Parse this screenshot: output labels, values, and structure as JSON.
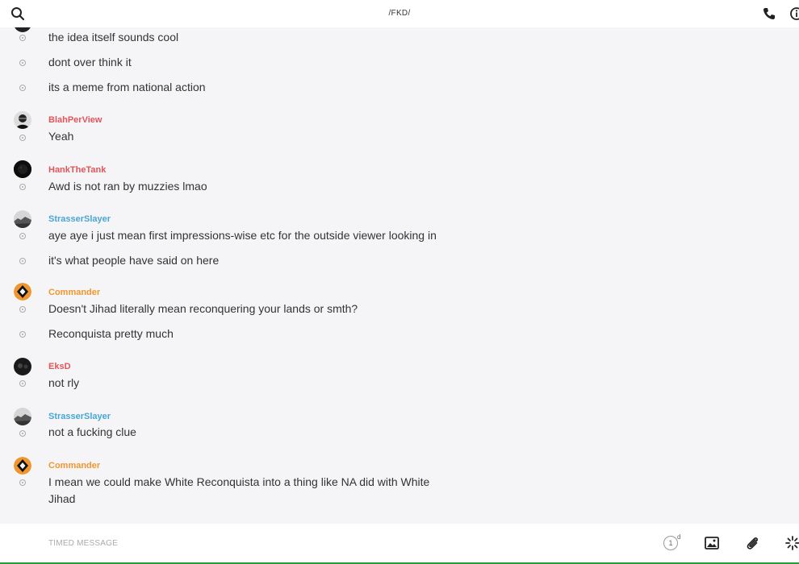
{
  "header": {
    "title": "/FKD/"
  },
  "composer": {
    "placeholder": "TIMED MESSAGE",
    "timer_value": "1",
    "timer_unit": "d"
  },
  "colors": {
    "red": "#e0555a",
    "blue": "#48a6d6",
    "orange": "#f0962e"
  },
  "messages": {
    "m0": {
      "text": "the idea itself sounds cool"
    },
    "m1": {
      "text": "dont over think it"
    },
    "m2": {
      "text": "its a meme from national action"
    },
    "m3": {
      "sender": "BlahPerView",
      "text": "Yeah"
    },
    "m4": {
      "sender": "HankTheTank",
      "text": "Awd is not ran by muzzies lmao"
    },
    "m5": {
      "sender": "StrasserSlayer",
      "text": "aye aye i just mean first impressions-wise etc for the outside viewer looking in"
    },
    "m6": {
      "text": "it's what people have said on here"
    },
    "m7": {
      "sender": "Commander",
      "text": "Doesn't Jihad literally mean reconquering your lands or smth?"
    },
    "m8": {
      "text": "Reconquista pretty much"
    },
    "m9": {
      "sender": "EksD",
      "text": "not rly"
    },
    "m10": {
      "sender": "StrasserSlayer",
      "text": "not a fucking clue"
    },
    "m11": {
      "sender": "Commander",
      "text": "I mean we could make White Reconquista into a thing like NA did with White Jihad"
    }
  }
}
